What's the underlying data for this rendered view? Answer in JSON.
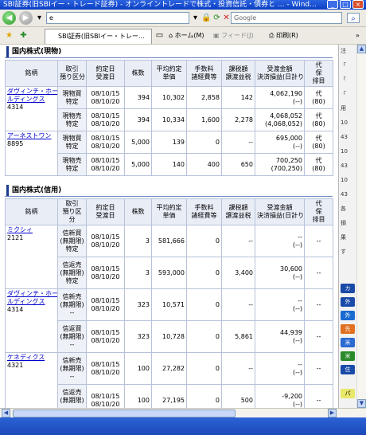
{
  "window": {
    "title": "SBI証券(旧SBIイー・トレード証券) - オンライントレードで株式・投資信託・債券と ... - Wind..."
  },
  "toolbar": {
    "address": "e",
    "search_placeholder": "Google",
    "tab_label": "SBI証券(旧SBIイー・トレー...",
    "home_label": "ホーム(M)",
    "feed_label": "フィード(J)",
    "print_label": "印刷(R)"
  },
  "cash_section": {
    "title": "国内株式(現物)",
    "headers": [
      "銘柄",
      "取引/預り区分",
      "約定日/受渡日",
      "株数",
      "平均約定/単価",
      "手数料/諸経費等",
      "課税額/譲渡益税",
      "受渡金額/決済損益(日計り分)",
      "代/保/排目"
    ],
    "rows": [
      {
        "name1": "ダヴィンチ・ホー",
        "name2": "ルディングス",
        "code": "4314",
        "k1": "現物買",
        "k2": "特定",
        "d1": "08/10/15",
        "d2": "08/10/20",
        "qty": "394",
        "price": "10,302",
        "fee": "2,858",
        "tax": "142",
        "amt1": "4,062,190",
        "amt2": "(--)",
        "c1": "代",
        "c2": "(80)"
      },
      {
        "name1": "",
        "name2": "",
        "code": "",
        "k1": "現物売",
        "k2": "特定",
        "d1": "08/10/15",
        "d2": "08/10/20",
        "qty": "394",
        "price": "10,334",
        "fee": "1,600",
        "tax": "2,278",
        "amt1": "4,068,052",
        "amt2": "(4,068,052)",
        "c1": "代",
        "c2": "(80)"
      },
      {
        "name1": "アーネストワン",
        "name2": "",
        "code": "8895",
        "k1": "現物買",
        "k2": "特定",
        "d1": "08/10/15",
        "d2": "08/10/20",
        "qty": "5,000",
        "price": "139",
        "fee": "0",
        "tax": "--",
        "amt1": "695,000",
        "amt2": "(--)",
        "c1": "代",
        "c2": "(80)"
      },
      {
        "name1": "",
        "name2": "",
        "code": "",
        "k1": "現物売",
        "k2": "特定",
        "d1": "08/10/15",
        "d2": "08/10/20",
        "qty": "5,000",
        "price": "140",
        "fee": "400",
        "tax": "650",
        "amt1": "700,250",
        "amt2": "(700,250)",
        "c1": "代",
        "c2": "(80)"
      }
    ]
  },
  "margin_section": {
    "title": "国内株式(信用)",
    "headers": [
      "銘柄",
      "取引/預り区/分",
      "約定日/受渡日",
      "株数",
      "平均約定/単価",
      "手数料/諸経費等",
      "課税額/譲渡益税",
      "受渡金額/決済損益(日計り分)",
      "代/保/排目"
    ],
    "rows": [
      {
        "name1": "ミクシィ",
        "name2": "",
        "code": "2121",
        "k1": "信新買",
        "k2": "(無期限)",
        "k3": "特定",
        "d1": "08/10/15",
        "d2": "08/10/20",
        "qty": "3",
        "price": "581,666",
        "fee": "0",
        "tax": "--",
        "amt1": "--",
        "amt2": "(--)",
        "c1": "--"
      },
      {
        "name1": "",
        "name2": "",
        "code": "",
        "k1": "信返売",
        "k2": "(無期限)",
        "k3": "特定",
        "d1": "08/10/15",
        "d2": "08/10/20",
        "qty": "3",
        "price": "593,000",
        "fee": "0",
        "tax": "3,400",
        "amt1": "30,600",
        "amt2": "(--)",
        "c1": "--"
      },
      {
        "name1": "ダヴィンチ・ホー",
        "name2": "ルディングス",
        "code": "4314",
        "k1": "信新売",
        "k2": "(無期限)",
        "k3": "--",
        "d1": "08/10/15",
        "d2": "08/10/20",
        "qty": "323",
        "price": "10,571",
        "fee": "0",
        "tax": "--",
        "amt1": "--",
        "amt2": "(--)",
        "c1": "--"
      },
      {
        "name1": "",
        "name2": "",
        "code": "",
        "k1": "信返買",
        "k2": "(無期限)",
        "k3": "--",
        "d1": "08/10/15",
        "d2": "08/10/20",
        "qty": "323",
        "price": "10,728",
        "fee": "0",
        "tax": "5,861",
        "amt1": "44,939",
        "amt2": "(--)",
        "c1": "--"
      },
      {
        "name1": "ケネディクス",
        "name2": "",
        "code": "4321",
        "k1": "信新売",
        "k2": "(無期限)",
        "k3": "--",
        "d1": "08/10/15",
        "d2": "08/10/20",
        "qty": "100",
        "price": "27,282",
        "fee": "0",
        "tax": "--",
        "amt1": "--",
        "amt2": "(--)",
        "c1": "--"
      },
      {
        "name1": "",
        "name2": "",
        "code": "",
        "k1": "信返売",
        "k2": "(無期限)",
        "k3": "--",
        "d1": "08/10/15",
        "d2": "08/10/20",
        "qty": "100",
        "price": "27,195",
        "fee": "0",
        "tax": "500",
        "amt1": "-9,200",
        "amt2": "(--)",
        "c1": "--"
      }
    ]
  },
  "sidebar": {
    "items": [
      "注",
      "「",
      "「",
      "「",
      "用",
      "10",
      "43",
      "10",
      "43",
      "10",
      "43",
      "各",
      "損",
      "果",
      "す",
      "カ",
      "外",
      "外",
      "先",
      "米",
      "米",
      "住",
      "パ"
    ]
  }
}
